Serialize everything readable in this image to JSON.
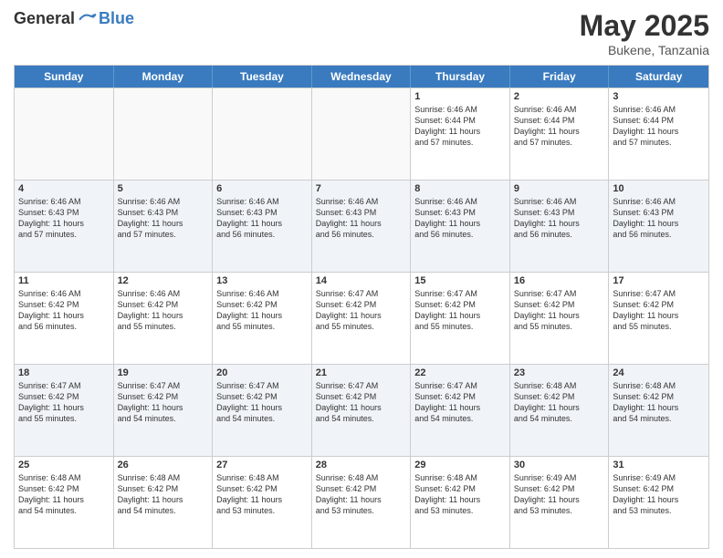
{
  "header": {
    "logo_general": "General",
    "logo_blue": "Blue",
    "month": "May 2025",
    "location": "Bukene, Tanzania"
  },
  "weekdays": [
    "Sunday",
    "Monday",
    "Tuesday",
    "Wednesday",
    "Thursday",
    "Friday",
    "Saturday"
  ],
  "rows": [
    {
      "cells": [
        {
          "day": "",
          "empty": true,
          "info": ""
        },
        {
          "day": "",
          "empty": true,
          "info": ""
        },
        {
          "day": "",
          "empty": true,
          "info": ""
        },
        {
          "day": "",
          "empty": true,
          "info": ""
        },
        {
          "day": "1",
          "info": "Sunrise: 6:46 AM\nSunset: 6:44 PM\nDaylight: 11 hours\nand 57 minutes."
        },
        {
          "day": "2",
          "info": "Sunrise: 6:46 AM\nSunset: 6:44 PM\nDaylight: 11 hours\nand 57 minutes."
        },
        {
          "day": "3",
          "info": "Sunrise: 6:46 AM\nSunset: 6:44 PM\nDaylight: 11 hours\nand 57 minutes."
        }
      ]
    },
    {
      "cells": [
        {
          "day": "4",
          "info": "Sunrise: 6:46 AM\nSunset: 6:43 PM\nDaylight: 11 hours\nand 57 minutes."
        },
        {
          "day": "5",
          "info": "Sunrise: 6:46 AM\nSunset: 6:43 PM\nDaylight: 11 hours\nand 57 minutes."
        },
        {
          "day": "6",
          "info": "Sunrise: 6:46 AM\nSunset: 6:43 PM\nDaylight: 11 hours\nand 56 minutes."
        },
        {
          "day": "7",
          "info": "Sunrise: 6:46 AM\nSunset: 6:43 PM\nDaylight: 11 hours\nand 56 minutes."
        },
        {
          "day": "8",
          "info": "Sunrise: 6:46 AM\nSunset: 6:43 PM\nDaylight: 11 hours\nand 56 minutes."
        },
        {
          "day": "9",
          "info": "Sunrise: 6:46 AM\nSunset: 6:43 PM\nDaylight: 11 hours\nand 56 minutes."
        },
        {
          "day": "10",
          "info": "Sunrise: 6:46 AM\nSunset: 6:43 PM\nDaylight: 11 hours\nand 56 minutes."
        }
      ]
    },
    {
      "cells": [
        {
          "day": "11",
          "info": "Sunrise: 6:46 AM\nSunset: 6:42 PM\nDaylight: 11 hours\nand 56 minutes."
        },
        {
          "day": "12",
          "info": "Sunrise: 6:46 AM\nSunset: 6:42 PM\nDaylight: 11 hours\nand 55 minutes."
        },
        {
          "day": "13",
          "info": "Sunrise: 6:46 AM\nSunset: 6:42 PM\nDaylight: 11 hours\nand 55 minutes."
        },
        {
          "day": "14",
          "info": "Sunrise: 6:47 AM\nSunset: 6:42 PM\nDaylight: 11 hours\nand 55 minutes."
        },
        {
          "day": "15",
          "info": "Sunrise: 6:47 AM\nSunset: 6:42 PM\nDaylight: 11 hours\nand 55 minutes."
        },
        {
          "day": "16",
          "info": "Sunrise: 6:47 AM\nSunset: 6:42 PM\nDaylight: 11 hours\nand 55 minutes."
        },
        {
          "day": "17",
          "info": "Sunrise: 6:47 AM\nSunset: 6:42 PM\nDaylight: 11 hours\nand 55 minutes."
        }
      ]
    },
    {
      "cells": [
        {
          "day": "18",
          "info": "Sunrise: 6:47 AM\nSunset: 6:42 PM\nDaylight: 11 hours\nand 55 minutes."
        },
        {
          "day": "19",
          "info": "Sunrise: 6:47 AM\nSunset: 6:42 PM\nDaylight: 11 hours\nand 54 minutes."
        },
        {
          "day": "20",
          "info": "Sunrise: 6:47 AM\nSunset: 6:42 PM\nDaylight: 11 hours\nand 54 minutes."
        },
        {
          "day": "21",
          "info": "Sunrise: 6:47 AM\nSunset: 6:42 PM\nDaylight: 11 hours\nand 54 minutes."
        },
        {
          "day": "22",
          "info": "Sunrise: 6:47 AM\nSunset: 6:42 PM\nDaylight: 11 hours\nand 54 minutes."
        },
        {
          "day": "23",
          "info": "Sunrise: 6:48 AM\nSunset: 6:42 PM\nDaylight: 11 hours\nand 54 minutes."
        },
        {
          "day": "24",
          "info": "Sunrise: 6:48 AM\nSunset: 6:42 PM\nDaylight: 11 hours\nand 54 minutes."
        }
      ]
    },
    {
      "cells": [
        {
          "day": "25",
          "info": "Sunrise: 6:48 AM\nSunset: 6:42 PM\nDaylight: 11 hours\nand 54 minutes."
        },
        {
          "day": "26",
          "info": "Sunrise: 6:48 AM\nSunset: 6:42 PM\nDaylight: 11 hours\nand 54 minutes."
        },
        {
          "day": "27",
          "info": "Sunrise: 6:48 AM\nSunset: 6:42 PM\nDaylight: 11 hours\nand 53 minutes."
        },
        {
          "day": "28",
          "info": "Sunrise: 6:48 AM\nSunset: 6:42 PM\nDaylight: 11 hours\nand 53 minutes."
        },
        {
          "day": "29",
          "info": "Sunrise: 6:48 AM\nSunset: 6:42 PM\nDaylight: 11 hours\nand 53 minutes."
        },
        {
          "day": "30",
          "info": "Sunrise: 6:49 AM\nSunset: 6:42 PM\nDaylight: 11 hours\nand 53 minutes."
        },
        {
          "day": "31",
          "info": "Sunrise: 6:49 AM\nSunset: 6:42 PM\nDaylight: 11 hours\nand 53 minutes."
        }
      ]
    }
  ]
}
